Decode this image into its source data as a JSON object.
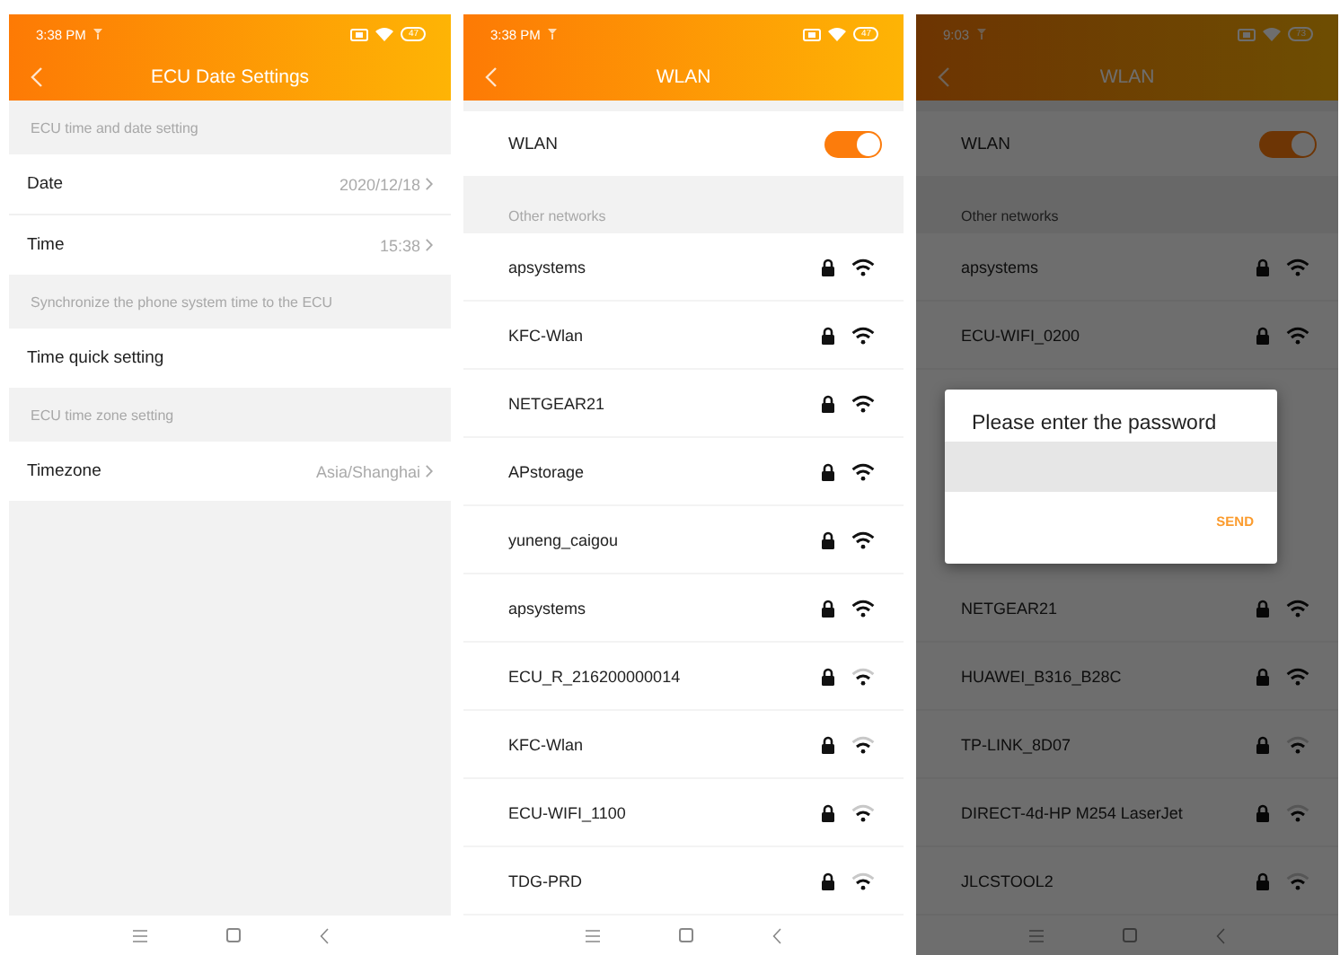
{
  "date_settings_screen": {
    "status_bar": {
      "time": "3:38 PM",
      "battery": "47"
    },
    "title": "ECU Date Settings",
    "sections": [
      {
        "header": "ECU time and date setting",
        "rows": [
          {
            "label": "Date",
            "value": "2020/12/18"
          },
          {
            "label": "Time",
            "value": "15:38"
          }
        ]
      },
      {
        "header": "Synchronize the phone system time to the ECU",
        "rows": [
          {
            "label": "Time quick setting"
          }
        ]
      },
      {
        "header": "ECU time zone setting",
        "rows": [
          {
            "label": "Timezone",
            "value": "Asia/Shanghai"
          }
        ]
      }
    ]
  },
  "wlan_screen": {
    "status_bar": {
      "time": "3:38 PM",
      "battery": "47"
    },
    "title": "WLAN",
    "toggle": {
      "label": "WLAN",
      "on": true
    },
    "section_header": "Other networks",
    "networks": [
      {
        "name": "apsystems",
        "locked": true,
        "strong": true
      },
      {
        "name": "KFC-Wlan",
        "locked": true,
        "strong": true
      },
      {
        "name": "NETGEAR21",
        "locked": true,
        "strong": true
      },
      {
        "name": "APstorage",
        "locked": true,
        "strong": true
      },
      {
        "name": "yuneng_caigou",
        "locked": true,
        "strong": true
      },
      {
        "name": "apsystems",
        "locked": true,
        "strong": true
      },
      {
        "name": "ECU_R_216200000014",
        "locked": true,
        "strong": false
      },
      {
        "name": "KFC-Wlan",
        "locked": true,
        "strong": false
      },
      {
        "name": "ECU-WIFI_1100",
        "locked": true,
        "strong": false
      },
      {
        "name": "TDG-PRD",
        "locked": true,
        "strong": false
      }
    ]
  },
  "wlan_password_screen": {
    "status_bar": {
      "time": "9:03",
      "battery": "73"
    },
    "title": "WLAN",
    "toggle": {
      "label": "WLAN",
      "on": true
    },
    "section_header": "Other networks",
    "networks_above_dialog": [
      {
        "name": "apsystems",
        "locked": true,
        "strong": true
      },
      {
        "name": "ECU-WIFI_0200",
        "locked": true,
        "strong": true
      }
    ],
    "networks_below_dialog": [
      {
        "name": "NETGEAR21",
        "locked": true,
        "strong": true
      },
      {
        "name": "HUAWEI_B316_B28C",
        "locked": true,
        "strong": true
      },
      {
        "name": "TP-LINK_8D07",
        "locked": true,
        "strong": false
      },
      {
        "name": "DIRECT-4d-HP M254 LaserJet",
        "locked": true,
        "strong": false
      },
      {
        "name": "JLCSTOOL2",
        "locked": true,
        "strong": false
      }
    ],
    "dialog": {
      "title": "Please enter the password",
      "button": "SEND"
    }
  }
}
